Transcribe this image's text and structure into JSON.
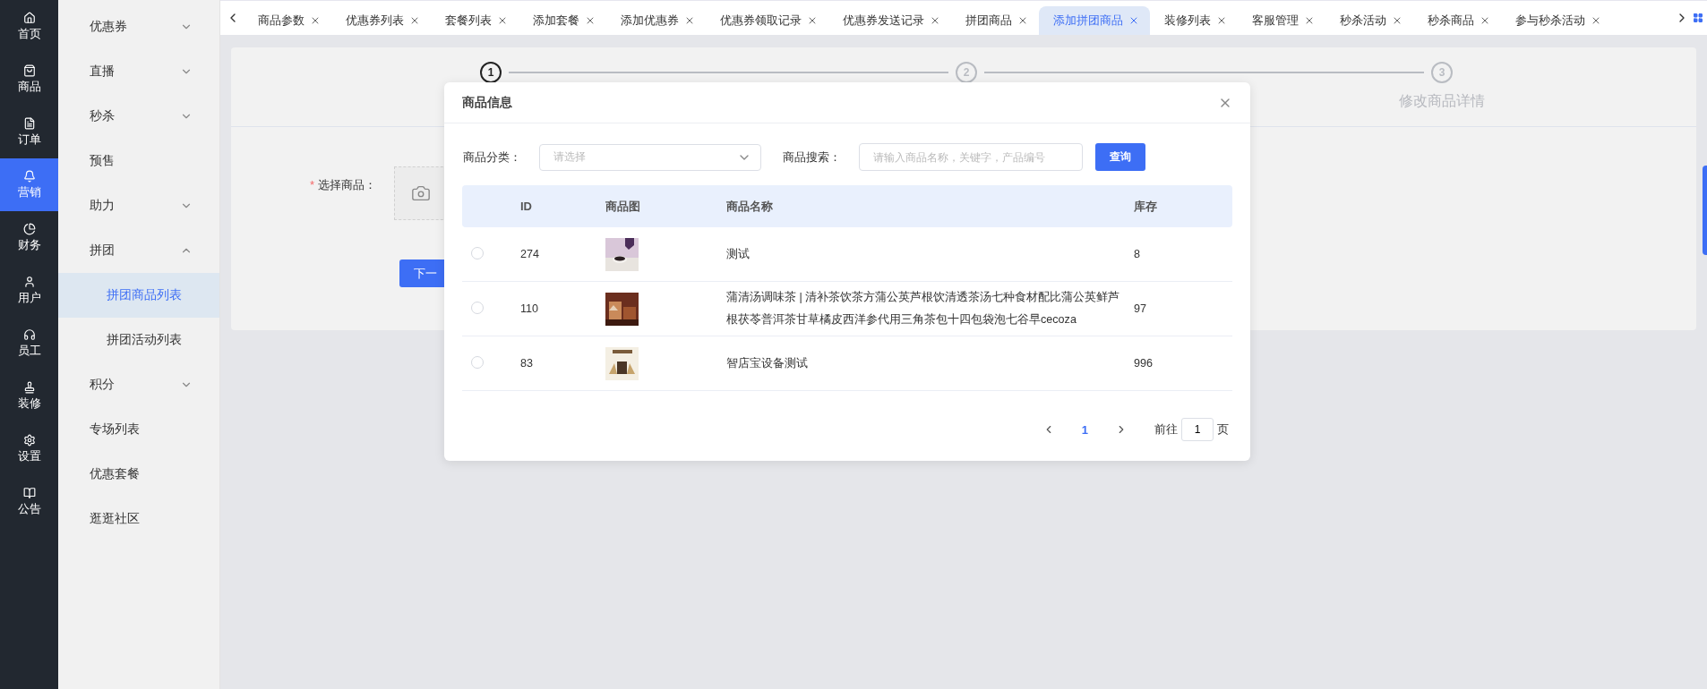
{
  "rail": [
    {
      "label": "首页",
      "selected": false
    },
    {
      "label": "商品",
      "selected": false
    },
    {
      "label": "订单",
      "selected": false
    },
    {
      "label": "营销",
      "selected": true
    },
    {
      "label": "财务",
      "selected": false
    },
    {
      "label": "用户",
      "selected": false
    },
    {
      "label": "员工",
      "selected": false
    },
    {
      "label": "装修",
      "selected": false
    },
    {
      "label": "设置",
      "selected": false
    },
    {
      "label": "公告",
      "selected": false
    }
  ],
  "sidebar": {
    "items": [
      {
        "label": "优惠券",
        "kind": "group",
        "expanded": false
      },
      {
        "label": "直播",
        "kind": "group",
        "expanded": false
      },
      {
        "label": "秒杀",
        "kind": "group",
        "expanded": false
      },
      {
        "label": "预售",
        "kind": "link"
      },
      {
        "label": "助力",
        "kind": "group",
        "expanded": false
      },
      {
        "label": "拼团",
        "kind": "group",
        "expanded": true,
        "children": [
          {
            "label": "拼团商品列表",
            "selected": true
          },
          {
            "label": "拼团活动列表",
            "selected": false
          }
        ]
      },
      {
        "label": "积分",
        "kind": "group",
        "expanded": false
      },
      {
        "label": "专场列表",
        "kind": "link"
      },
      {
        "label": "优惠套餐",
        "kind": "link"
      },
      {
        "label": "逛逛社区",
        "kind": "link"
      }
    ]
  },
  "tabs": [
    {
      "label": "商品参数",
      "selected": false
    },
    {
      "label": "优惠券列表",
      "selected": false
    },
    {
      "label": "套餐列表",
      "selected": false
    },
    {
      "label": "添加套餐",
      "selected": false
    },
    {
      "label": "添加优惠券",
      "selected": false
    },
    {
      "label": "优惠券领取记录",
      "selected": false
    },
    {
      "label": "优惠券发送记录",
      "selected": false
    },
    {
      "label": "拼团商品",
      "selected": false
    },
    {
      "label": "添加拼团商品",
      "selected": true
    },
    {
      "label": "装修列表",
      "selected": false
    },
    {
      "label": "客服管理",
      "selected": false
    },
    {
      "label": "秒杀活动",
      "selected": false
    },
    {
      "label": "秒杀商品",
      "selected": false
    },
    {
      "label": "参与秒杀活动",
      "selected": false
    }
  ],
  "steps": [
    {
      "number": "1",
      "active": true
    },
    {
      "number": "2",
      "active": false
    },
    {
      "number": "3",
      "active": false,
      "label": "修改商品详情"
    }
  ],
  "form": {
    "label": "选择商品：",
    "required_mark": "*",
    "button": "下一"
  },
  "dialog": {
    "title": "商品信息",
    "filters": {
      "category_label": "商品分类：",
      "category_placeholder": "请选择",
      "search_label": "商品搜索：",
      "search_placeholder": "请输入商品名称，关键字，产品编号",
      "button": "查询"
    },
    "table": {
      "columns": [
        "ID",
        "商品图",
        "商品名称",
        "库存"
      ],
      "rows": [
        {
          "selected": false,
          "id": "274",
          "name": "测试",
          "stock": "8"
        },
        {
          "selected": false,
          "id": "110",
          "name": "蒲清汤调味茶 | 清补茶饮茶方蒲公英芦根饮清透茶汤七种食材配比蒲公英鲜芦根茯苓普洱茶甘草橘皮西洋参代用三角茶包十四包袋泡七谷早cecoza",
          "stock": "97"
        },
        {
          "selected": false,
          "id": "83",
          "name": "智店宝设备测试",
          "stock": "996"
        }
      ]
    },
    "pagination": {
      "current": "1",
      "goto_label": "前往",
      "goto_value": "1",
      "page_suffix": "页"
    }
  }
}
